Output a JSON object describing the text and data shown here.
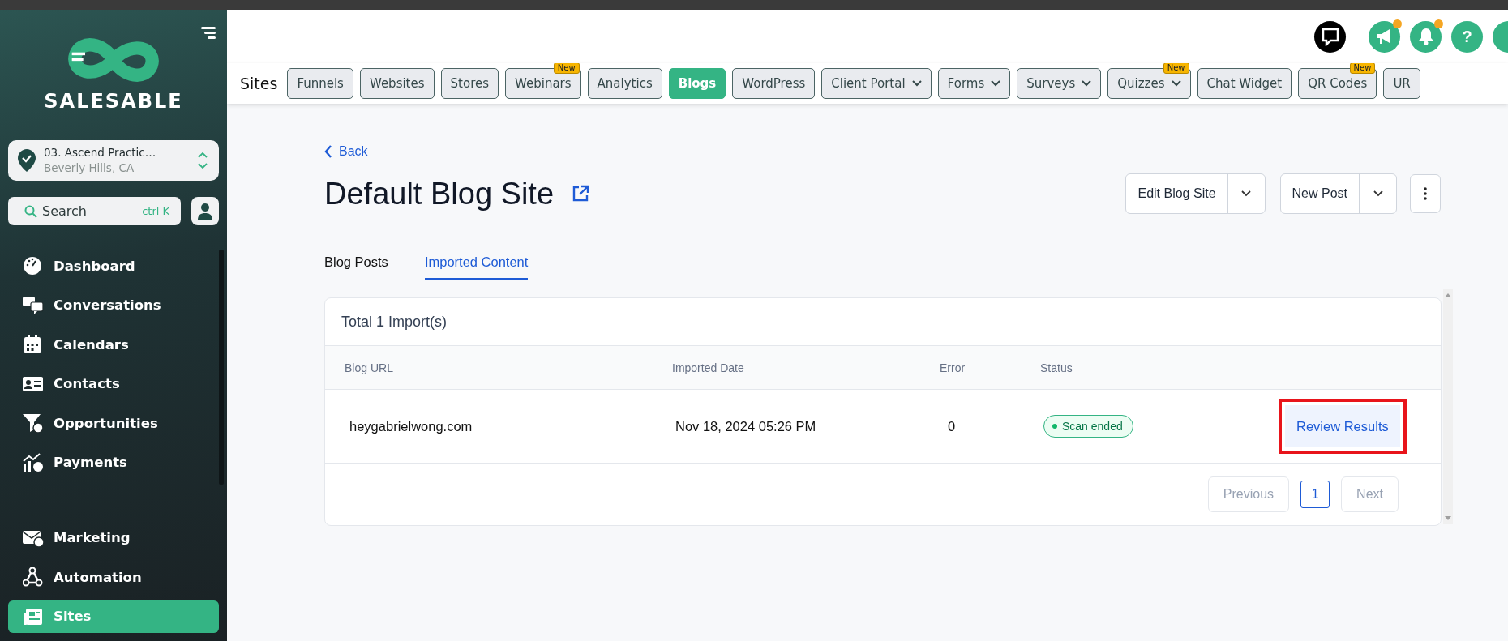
{
  "sidebar": {
    "brand": "SALESABLE",
    "location": {
      "name": "03. Ascend Practic…",
      "address": "Beverly Hills, CA"
    },
    "search": {
      "placeholder": "Search",
      "shortcut": "ctrl K"
    },
    "sections": [
      {
        "items": [
          {
            "label": "Dashboard",
            "selected": false
          },
          {
            "label": "Conversations",
            "selected": false
          },
          {
            "label": "Calendars",
            "selected": false
          },
          {
            "label": "Contacts",
            "selected": false
          },
          {
            "label": "Opportunities",
            "selected": false
          },
          {
            "label": "Payments",
            "selected": false
          }
        ]
      },
      {
        "items": [
          {
            "label": "Marketing",
            "selected": false
          },
          {
            "label": "Automation",
            "selected": false
          },
          {
            "label": "Sites",
            "selected": true
          }
        ]
      }
    ]
  },
  "header": {
    "icons": [
      {
        "notify": false
      },
      {
        "notify": true
      },
      {
        "notify": true
      },
      {
        "text": "?",
        "notify": false
      },
      {
        "notify": false
      }
    ]
  },
  "nav": {
    "title": "Sites",
    "tabs": [
      {
        "label": "Funnels",
        "selected": false,
        "dropdown": false
      },
      {
        "label": "Websites",
        "selected": false,
        "dropdown": false
      },
      {
        "label": "Stores",
        "selected": false,
        "dropdown": false
      },
      {
        "label": "Webinars",
        "selected": false,
        "dropdown": false,
        "badge": "New"
      },
      {
        "label": "Analytics",
        "selected": false,
        "dropdown": false
      },
      {
        "label": "Blogs",
        "selected": true,
        "dropdown": false
      },
      {
        "label": "WordPress",
        "selected": false,
        "dropdown": false
      },
      {
        "label": "Client Portal",
        "selected": false,
        "dropdown": true
      },
      {
        "label": "Forms",
        "selected": false,
        "dropdown": true
      },
      {
        "label": "Surveys",
        "selected": false,
        "dropdown": true
      },
      {
        "label": "Quizzes",
        "selected": false,
        "dropdown": true,
        "badge": "New"
      },
      {
        "label": "Chat Widget",
        "selected": false,
        "dropdown": false
      },
      {
        "label": "QR Codes",
        "selected": false,
        "dropdown": false,
        "badge": "New"
      },
      {
        "label": "UR",
        "selected": false,
        "dropdown": false
      }
    ]
  },
  "page": {
    "back": "Back",
    "title": "Default Blog Site",
    "actions": [
      {
        "label": "Edit Blog Site"
      },
      {
        "label": "New Post"
      }
    ],
    "tabs": [
      {
        "label": "Blog Posts",
        "selected": false
      },
      {
        "label": "Imported Content",
        "selected": true
      }
    ],
    "table": {
      "summary": "Total 1 Import(s)",
      "columns": [
        "Blog URL",
        "Imported Date",
        "Error",
        "Status"
      ],
      "rows": [
        {
          "url": "heygabrielwong.com",
          "date": "Nov 18, 2024 05:26 PM",
          "error": "0",
          "status": "Scan ended",
          "action": "Review Results",
          "highlighted": true
        }
      ]
    },
    "pagination": {
      "previous": {
        "label": "Previous",
        "disabled": true
      },
      "pages": [
        {
          "label": "1",
          "selected": true
        }
      ],
      "next": {
        "label": "Next",
        "disabled": true
      }
    }
  }
}
